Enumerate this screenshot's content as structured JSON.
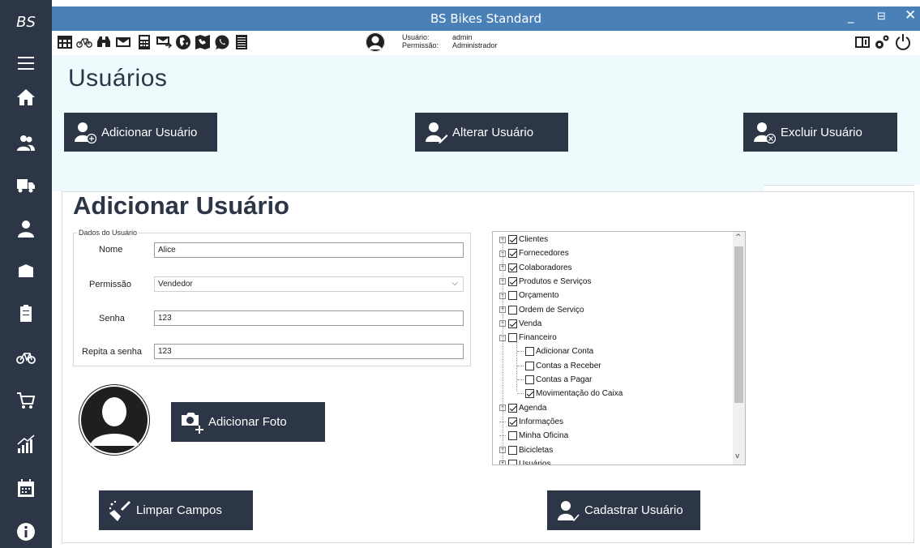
{
  "app": {
    "brand": "BS",
    "window_title": "BS Bikes Standard"
  },
  "window_controls": {
    "minimize": "_",
    "maximize": "⊟",
    "close": "✕"
  },
  "sidebar": {
    "items": [
      {
        "name": "menu-icon"
      },
      {
        "name": "home-icon"
      },
      {
        "name": "clients-icon"
      },
      {
        "name": "suppliers-truck-icon"
      },
      {
        "name": "user-icon"
      },
      {
        "name": "box-icon"
      },
      {
        "name": "clipboard-icon"
      },
      {
        "name": "bicycle-icon"
      },
      {
        "name": "cart-icon"
      },
      {
        "name": "chart-icon"
      },
      {
        "name": "calendar-icon"
      },
      {
        "name": "info-icon"
      }
    ]
  },
  "toolbar": {
    "icons": [
      "calculator-grid-icon",
      "bicycle-icon",
      "binoculars-icon",
      "mail-icon",
      "calculator-icon",
      "mail-forward-icon",
      "globe-icon",
      "map-icon",
      "whatsapp-icon",
      "notes-icon"
    ],
    "user_label": "Usuário:",
    "user_value": "admin",
    "permission_label": "Permissão:",
    "permission_value": "Administrador",
    "right_icons": [
      "manual-icon",
      "settings-icon",
      "power-icon"
    ]
  },
  "page": {
    "title": "Usuários",
    "buttons": {
      "add": "Adicionar Usuário",
      "edit": "Alterar Usuário",
      "delete": "Excluir Usuário"
    }
  },
  "form": {
    "heading": "Adicionar Usuário",
    "group_label": "Dados do Usuário",
    "name_label": "Nome",
    "name_value": "Alice",
    "permission_label": "Permissão",
    "permission_value": "Vendedor",
    "password_label": "Senha",
    "password_value": "123",
    "repeat_label": "Repita a senha",
    "repeat_value": "123",
    "add_photo": "Adicionar Foto",
    "clear": "Limpar Campos",
    "submit": "Cadastrar Usuário"
  },
  "permissions_tree": [
    {
      "label": "Clientes",
      "checked": true,
      "expander": "+",
      "level": 0
    },
    {
      "label": "Fornecedores",
      "checked": true,
      "expander": "+",
      "level": 0
    },
    {
      "label": "Colaboradores",
      "checked": true,
      "expander": "+",
      "level": 0
    },
    {
      "label": "Produtos e Serviços",
      "checked": true,
      "expander": "+",
      "level": 0
    },
    {
      "label": "Orçamento",
      "checked": false,
      "expander": "+",
      "level": 0
    },
    {
      "label": "Ordem de Serviço",
      "checked": false,
      "expander": "+",
      "level": 0
    },
    {
      "label": "Venda",
      "checked": true,
      "expander": "+",
      "level": 0
    },
    {
      "label": "Financeiro",
      "checked": false,
      "expander": "−",
      "level": 0
    },
    {
      "label": "Adicionar Conta",
      "checked": false,
      "expander": "",
      "level": 1
    },
    {
      "label": "Contas a Receber",
      "checked": false,
      "expander": "",
      "level": 1
    },
    {
      "label": "Contas a Pagar",
      "checked": false,
      "expander": "",
      "level": 1
    },
    {
      "label": "Movimentação do Caixa",
      "checked": true,
      "expander": "",
      "level": 1
    },
    {
      "label": "Agenda",
      "checked": true,
      "expander": "+",
      "level": 0
    },
    {
      "label": "Informações",
      "checked": true,
      "expander": "",
      "level": 0
    },
    {
      "label": "Minha Oficina",
      "checked": false,
      "expander": "",
      "level": 0
    },
    {
      "label": "Bicicletas",
      "checked": false,
      "expander": "+",
      "level": 0
    },
    {
      "label": "Usuários",
      "checked": false,
      "expander": "+",
      "level": 0
    }
  ],
  "colors": {
    "sidebar": "#2c3646",
    "titlebar": "#4a80b8",
    "content_bg": "#effafd",
    "button": "#2c3646"
  }
}
